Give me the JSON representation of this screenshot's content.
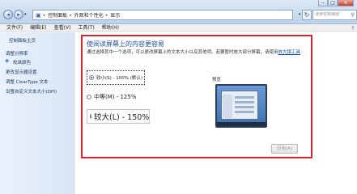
{
  "addressbar": {
    "crumbs": [
      "控制面板",
      "外观和个性化",
      "显示"
    ],
    "search_placeholder": "搜索控制面板"
  },
  "menu": [
    "文件(F)",
    "编辑(E)",
    "查看(V)",
    "工具(T)",
    "帮助(H)"
  ],
  "sidebar": {
    "home": "控制面板主页",
    "items": [
      "调整分辨率",
      "校准颜色",
      "更改显示器设置",
      "调整 ClearType 文本",
      "设置自定义文本大小(DPI)"
    ]
  },
  "main": {
    "heading": "使阅读屏幕上的内容更容易",
    "description": "通过选择其中一个选项，可以更改屏幕上的文本大小以及其他项。若要暂时放大部分屏幕，请使用",
    "description_link": "放大镜工具",
    "options": [
      {
        "label": "较小(S) - 100% (默认)",
        "checked": true
      },
      {
        "label": "中等(M) - 125%",
        "checked": false
      },
      {
        "label": "较大(L) - 150%",
        "checked": false
      }
    ],
    "preview_label": "预览",
    "apply_label": "应用(A)"
  }
}
